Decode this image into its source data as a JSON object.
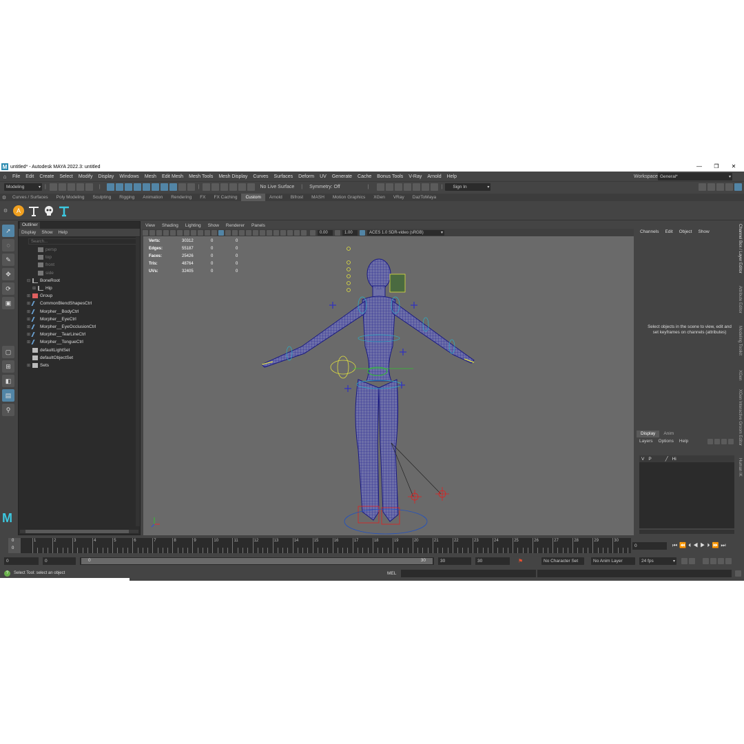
{
  "window": {
    "title": "untitled* - Autodesk MAYA 2022.3: untitled",
    "logo": "M",
    "controls": [
      "—",
      "❐",
      "✕"
    ]
  },
  "menubar": {
    "items": [
      "File",
      "Edit",
      "Create",
      "Select",
      "Modify",
      "Display",
      "Windows",
      "Mesh",
      "Edit Mesh",
      "Mesh Tools",
      "Mesh Display",
      "Curves",
      "Surfaces",
      "Deform",
      "UV",
      "Generate",
      "Cache",
      "Bonus Tools",
      "V-Ray",
      "Arnold",
      "Help"
    ],
    "workspace_label": "Workspace:",
    "workspace_value": "General*"
  },
  "toolbar": {
    "mode": "Modeling",
    "live_surface": "No Live Surface",
    "symmetry": "Symmetry: Off",
    "sign_in": "Sign In"
  },
  "shelf": {
    "tabs": [
      "Curves / Surfaces",
      "Poly Modeling",
      "Sculpting",
      "Rigging",
      "Animation",
      "Rendering",
      "FX",
      "FX Caching",
      "Custom",
      "Arnold",
      "Bifrost",
      "MASH",
      "Motion Graphics",
      "XGen",
      "VRay",
      "DazToMaya"
    ],
    "active": "Custom"
  },
  "outliner": {
    "tab": "Outliner",
    "menu": [
      "Display",
      "Show",
      "Help"
    ],
    "search_placeholder": "Search...",
    "items": [
      {
        "label": "persp",
        "indent": 1,
        "dim": true,
        "icon": "camera-icon",
        "exp": ""
      },
      {
        "label": "top",
        "indent": 1,
        "dim": true,
        "icon": "camera-icon",
        "exp": ""
      },
      {
        "label": "front",
        "indent": 1,
        "dim": true,
        "icon": "camera-icon",
        "exp": ""
      },
      {
        "label": "side",
        "indent": 1,
        "dim": true,
        "icon": "camera-icon",
        "exp": ""
      },
      {
        "label": "BoneRoot",
        "indent": 0,
        "dim": false,
        "icon": "joint-icon",
        "exp": "⊟"
      },
      {
        "label": "Hip",
        "indent": 1,
        "dim": false,
        "icon": "joint-icon",
        "exp": "⊞"
      },
      {
        "label": "Group",
        "indent": 0,
        "dim": false,
        "icon": "group-icon",
        "exp": "⊞"
      },
      {
        "label": "CommonBlendShapesCtrl",
        "indent": 0,
        "dim": false,
        "icon": "curve-icon",
        "exp": "⊞"
      },
      {
        "label": "Morpher__BodyCtrl",
        "indent": 0,
        "dim": false,
        "icon": "curve-icon",
        "exp": "⊞"
      },
      {
        "label": "Morpher__EyeCtrl",
        "indent": 0,
        "dim": false,
        "icon": "curve-icon",
        "exp": "⊞"
      },
      {
        "label": "Morpher__EyeOcclusionCtrl",
        "indent": 0,
        "dim": false,
        "icon": "curve-icon",
        "exp": "⊞"
      },
      {
        "label": "Morpher__TearLineCtrl",
        "indent": 0,
        "dim": false,
        "icon": "curve-icon",
        "exp": "⊞"
      },
      {
        "label": "Morpher__TongueCtrl",
        "indent": 0,
        "dim": false,
        "icon": "curve-icon",
        "exp": "⊞"
      },
      {
        "label": "defaultLightSet",
        "indent": 0,
        "dim": false,
        "icon": "set-icon",
        "exp": ""
      },
      {
        "label": "defaultObjectSet",
        "indent": 0,
        "dim": false,
        "icon": "set-icon",
        "exp": ""
      },
      {
        "label": "Sets",
        "indent": 0,
        "dim": false,
        "icon": "set-icon",
        "exp": "⊞"
      }
    ]
  },
  "viewport": {
    "menu": [
      "View",
      "Shading",
      "Lighting",
      "Show",
      "Renderer",
      "Panels"
    ],
    "exposure": "0.00",
    "gamma": "1.00",
    "colorspace": "ACES 1.0 SDR-video (sRGB)",
    "hud": [
      {
        "label": "Verts:",
        "v": "30312",
        "a": "0",
        "b": "0"
      },
      {
        "label": "Edges:",
        "v": "55187",
        "a": "0",
        "b": "0"
      },
      {
        "label": "Faces:",
        "v": "25426",
        "a": "0",
        "b": "0"
      },
      {
        "label": "Tris:",
        "v": "48764",
        "a": "0",
        "b": "0"
      },
      {
        "label": "UVs:",
        "v": "32405",
        "a": "0",
        "b": "0"
      }
    ]
  },
  "channelbox": {
    "menu": [
      "Channels",
      "Edit",
      "Object",
      "Show"
    ],
    "hint": "Select objects in the scene to view, edit and set keyframes on channels (attributes)"
  },
  "layers": {
    "tabs": [
      "Display",
      "Anim"
    ],
    "menu": [
      "Layers",
      "Options",
      "Help"
    ],
    "row": {
      "v": "V",
      "p": "P",
      "name": "Hi"
    }
  },
  "sidetabs": [
    "Channel Box / Layer Editor",
    "Attribute Editor",
    "Modeling Toolkit",
    "XGen",
    "XGen Interactive Groom Editor",
    "Human IK"
  ],
  "timeline": {
    "ticks": [
      "1",
      "2",
      "3",
      "4",
      "5",
      "6",
      "7",
      "8",
      "9",
      "10",
      "11",
      "12",
      "13",
      "14",
      "15",
      "16",
      "17",
      "18",
      "19",
      "20",
      "21",
      "22",
      "23",
      "24",
      "25",
      "26",
      "27",
      "28",
      "29",
      "30"
    ],
    "current_top": "0",
    "current_bottom": "0",
    "frame_field": "0"
  },
  "range": {
    "start": "0",
    "start2": "0",
    "slider_left": "0",
    "slider_right": "30",
    "end": "30",
    "end2": "30",
    "char_set": "No Character Set",
    "anim_layer": "No Anim Layer",
    "fps": "24 fps"
  },
  "cmdline": {
    "lang": "MEL",
    "help": "Select Tool: select an object"
  },
  "colors": {
    "accent": "#5285a6",
    "wire": "#1d1d8f",
    "viewport_bg": "#6a6a6a"
  }
}
